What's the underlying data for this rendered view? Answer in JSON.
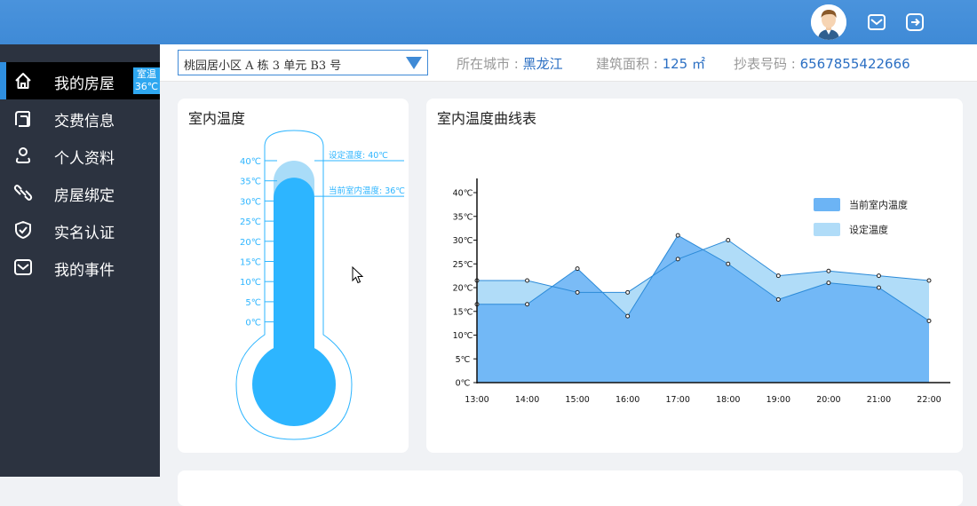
{
  "sidebar": {
    "items": [
      {
        "label": "我的房屋",
        "icon": "home-icon",
        "active": true
      },
      {
        "label": "交费信息",
        "icon": "bill-icon",
        "active": false
      },
      {
        "label": "个人资料",
        "icon": "user-icon",
        "active": false
      },
      {
        "label": "房屋绑定",
        "icon": "link-icon",
        "active": false
      },
      {
        "label": "实名认证",
        "icon": "shield-check-icon",
        "active": false
      },
      {
        "label": "我的事件",
        "icon": "mail-icon",
        "active": false
      }
    ],
    "badge": {
      "line1": "室温",
      "line2": "36℃"
    }
  },
  "infobar": {
    "house_select": "桃园居小区 A 栋 3 单元 B3 号",
    "city_label": "所在城市 : ",
    "city_value": "黑龙江",
    "area_label": "建筑面积 : ",
    "area_value": "125 ㎡",
    "meter_label": "抄表号码 : ",
    "meter_value": "6567855422666"
  },
  "thermometer": {
    "title": "室内温度",
    "scale": [
      "40℃",
      "35℃",
      "30℃",
      "25℃",
      "20℃",
      "15℃",
      "10℃",
      "5℃",
      "0℃"
    ],
    "set_label": "设定温度: 40℃",
    "current_label": "当前室内温度: 36℃",
    "set_temp": 40,
    "current_temp": 36
  },
  "chart_data": {
    "type": "area",
    "title": "室内温度曲线表",
    "categories": [
      "13:00",
      "14:00",
      "15:00",
      "16:00",
      "17:00",
      "18:00",
      "19:00",
      "20:00",
      "21:00",
      "22:00"
    ],
    "y_ticks": [
      "0℃",
      "5℃",
      "10℃",
      "15℃",
      "20℃",
      "25℃",
      "30℃",
      "35℃",
      "40℃"
    ],
    "ylim": [
      0,
      40
    ],
    "series": [
      {
        "name": "当前室内温度",
        "values": [
          16.5,
          16.5,
          24,
          14,
          31,
          25,
          17.5,
          21,
          20,
          13
        ],
        "color": "#6cb4f5"
      },
      {
        "name": "设定温度",
        "values": [
          21.5,
          21.5,
          19,
          19,
          26,
          30,
          22.5,
          23.5,
          22.5,
          21.5
        ],
        "color": "#b0dcf8"
      }
    ],
    "legend_position": "top-right"
  },
  "colors": {
    "topbar": "#3f8ad6",
    "sidebar": "#2c3340",
    "accent": "#2f8fe0",
    "thermo": "#2db5ff"
  }
}
